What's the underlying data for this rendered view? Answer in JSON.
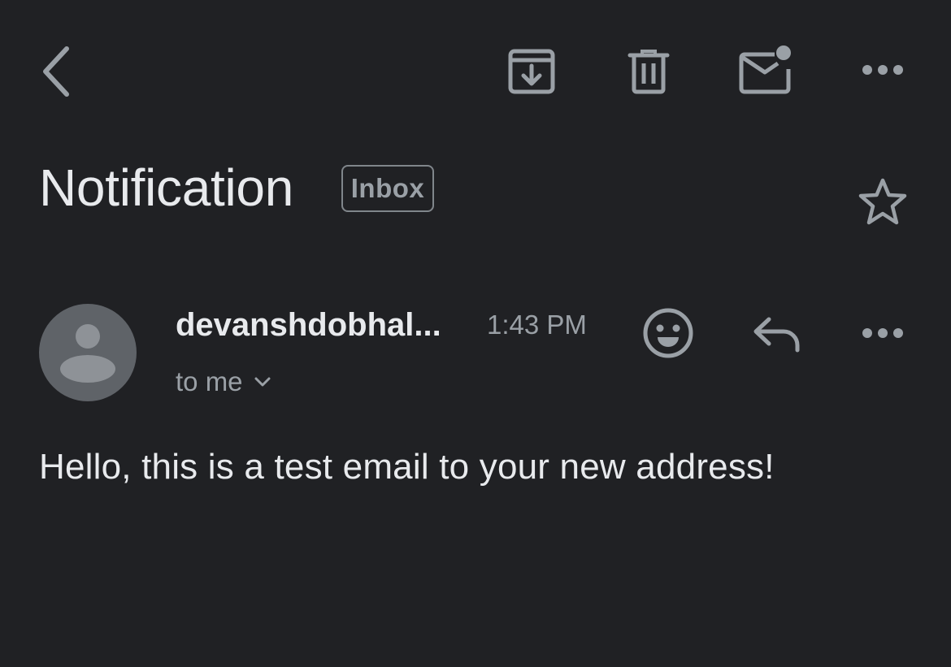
{
  "toolbar": {
    "back_icon": "chevron-left-icon",
    "archive_icon": "archive-icon",
    "delete_icon": "trash-icon",
    "mark_unread_icon": "mail-unread-icon",
    "more_icon": "more-horizontal-icon"
  },
  "email": {
    "subject": "Notification",
    "label": "Inbox",
    "star_icon": "star-outline-icon",
    "sender": {
      "name": "devanshdobhal...",
      "time": "1:43 PM",
      "recipient": "to me",
      "avatar_icon": "person-avatar-icon"
    },
    "actions": {
      "reaction_icon": "emoji-smile-icon",
      "reply_icon": "reply-icon",
      "more_icon": "more-horizontal-icon"
    },
    "body": "Hello, this is a test email to your new address!"
  },
  "colors": {
    "background": "#202124",
    "text_primary": "#e8eaed",
    "text_secondary": "#9aa0a6",
    "icon": "#9aa0a6",
    "avatar_bg": "#5f6368",
    "avatar_fg": "#8e9297",
    "chip_border": "#80868b"
  }
}
